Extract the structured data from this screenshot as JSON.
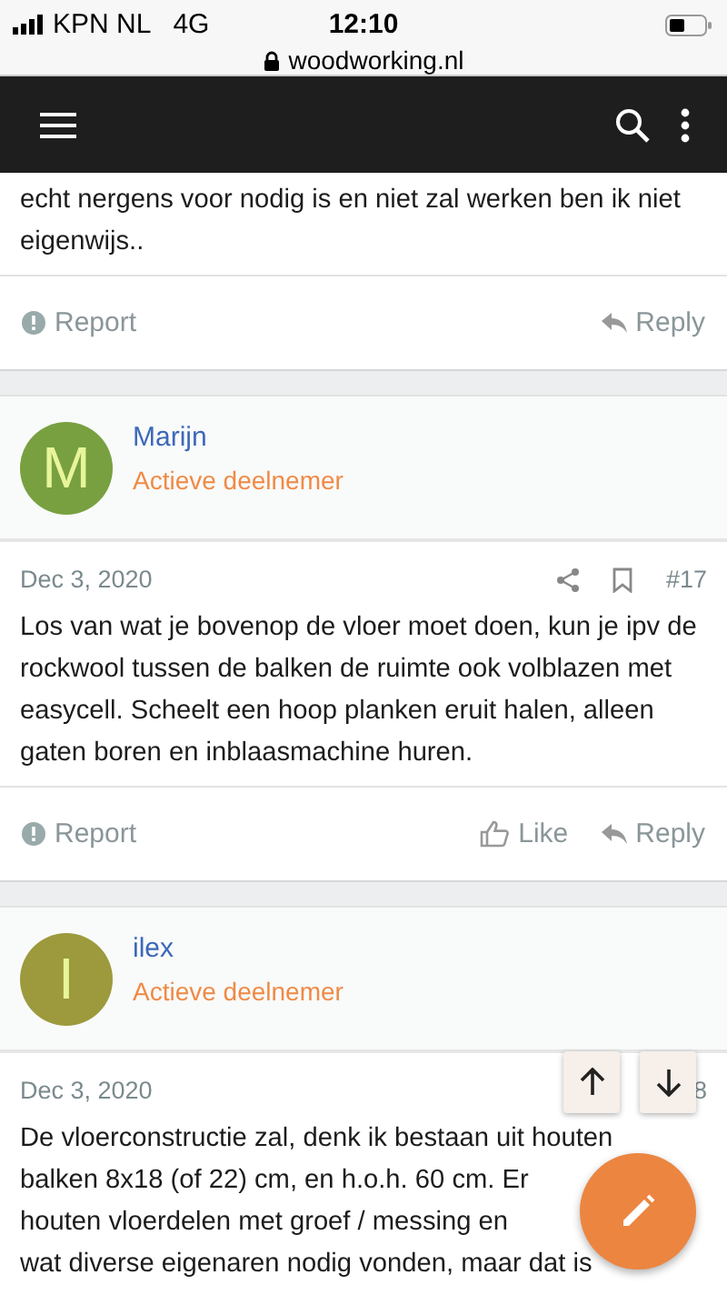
{
  "status_bar": {
    "carrier": "KPN NL",
    "network": "4G",
    "time": "12:10",
    "url": "woodworking.nl"
  },
  "posts": [
    {
      "body_lines": [
        "echt nergens voor nodig is en niet zal werken ben ik niet",
        "eigenwijs.."
      ],
      "actions": [
        {
          "kind": "report",
          "label": "Report"
        },
        {
          "kind": "reply",
          "label": "Reply"
        }
      ]
    },
    {
      "author": {
        "name": "Marijn",
        "role": "Actieve deelnemer",
        "initial": "M",
        "color": "#78a040"
      },
      "date": "Dec 3, 2020",
      "number": "#17",
      "icons": true,
      "body_lines": [
        "Los van wat je bovenop de vloer moet doen, kun je ipv de",
        "rockwool tussen de balken de ruimte ook volblazen met",
        "easycell. Scheelt een hoop planken eruit halen, alleen",
        "gaten boren en inblaasmachine huren."
      ],
      "actions": [
        {
          "kind": "report",
          "label": "Report"
        },
        {
          "kind": "like",
          "label": "Like"
        },
        {
          "kind": "reply",
          "label": "Reply"
        }
      ]
    },
    {
      "author": {
        "name": "ilex",
        "role": "Actieve deelnemer",
        "initial": "I",
        "color": "#9c9a3c"
      },
      "date": "Dec 3, 2020",
      "number": "8",
      "icons": false,
      "body_lines": [
        "De vloerconstructie zal, denk ik bestaan uit houten",
        "balken 8x18 (of 22) cm, en h.o.h. 60 cm. Er",
        "houten vloerdelen met groef / messing en",
        "wat diverse eigenaren nodig vonden, maar dat is"
      ]
    }
  ]
}
